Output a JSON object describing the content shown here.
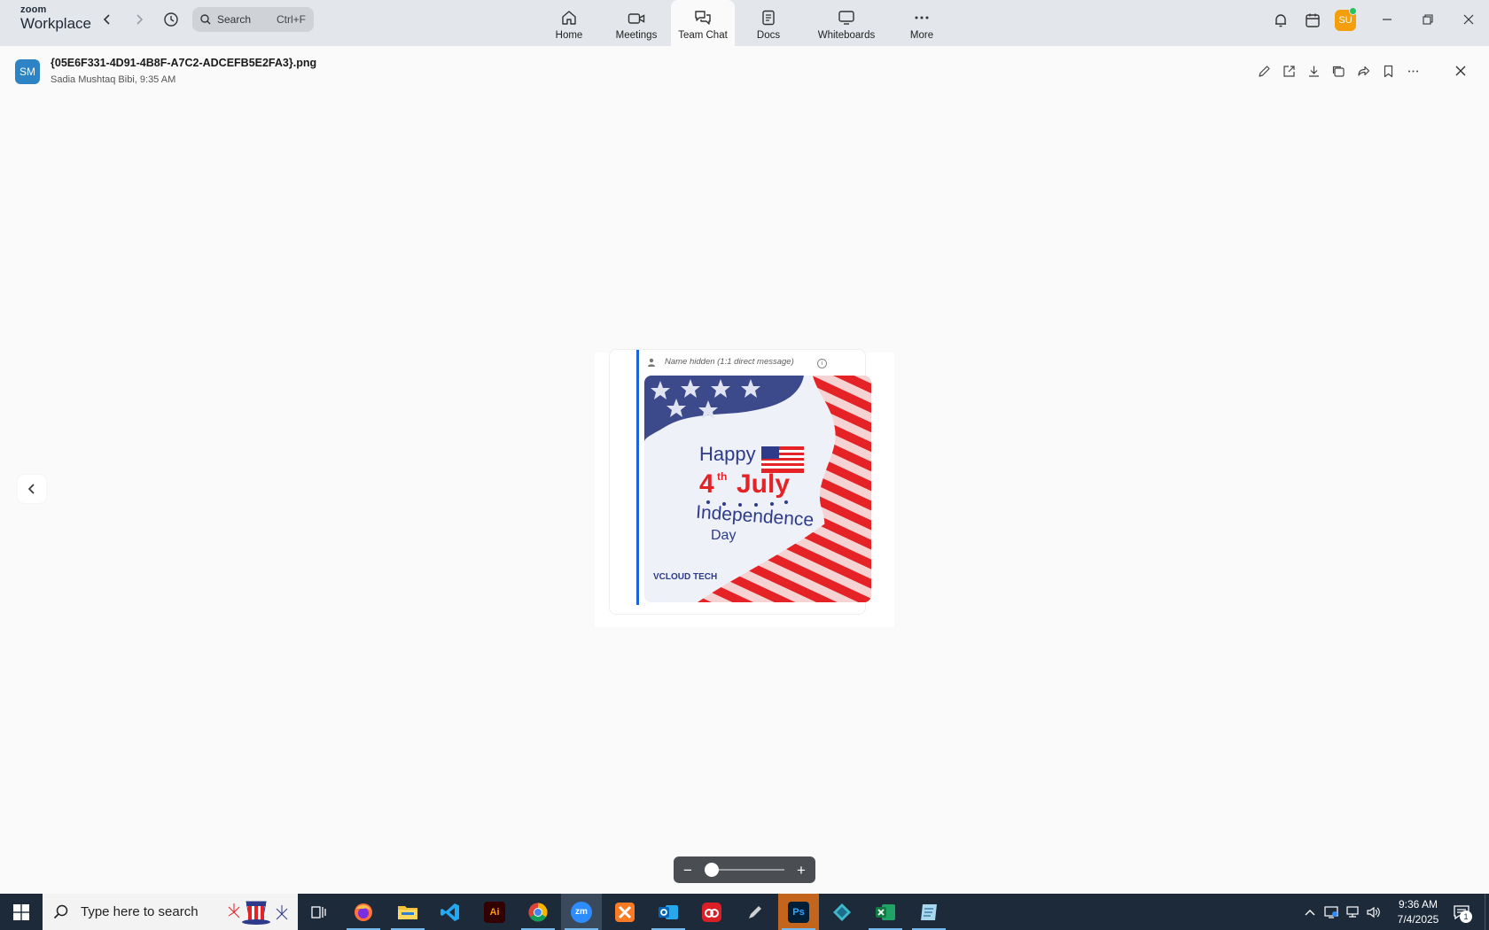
{
  "app": {
    "brand_top": "zoom",
    "brand_bottom": "Workplace"
  },
  "search": {
    "label": "Search",
    "shortcut": "Ctrl+F"
  },
  "tabs": [
    {
      "label": "Home",
      "icon": "home-icon"
    },
    {
      "label": "Meetings",
      "icon": "video-icon"
    },
    {
      "label": "Team Chat",
      "icon": "chat-icon",
      "active": true
    },
    {
      "label": "Docs",
      "icon": "document-icon"
    },
    {
      "label": "Whiteboards",
      "icon": "whiteboard-icon"
    },
    {
      "label": "More",
      "icon": "more-icon"
    }
  ],
  "user": {
    "initials": "SU",
    "avatar_color": "#f59e0b",
    "presence_color": "#22c55e"
  },
  "file": {
    "avatar_initials": "SM",
    "avatar_color": "#2d83c4",
    "name": "{05E6F331-4D91-4B8F-A7C2-ADCEFB5E2FA3}.png",
    "meta": "Sadia Mushtaq Bibi, 9:35 AM"
  },
  "preview": {
    "sender": "Name hidden (1:1 direct message)",
    "info_glyph": "i",
    "accent_color": "#1a64d6",
    "poster": {
      "line1": "Happy",
      "line2_num": "4",
      "line2_sup": "th",
      "line2_word": "July",
      "line3": "Independence",
      "line4": "Day",
      "brand": "VCLOUD TECH"
    }
  },
  "zoom_control": {
    "minus": "−",
    "plus": "+",
    "level_fraction": 0.0
  },
  "taskbar": {
    "search_placeholder": "Type here to search",
    "apps": [
      {
        "name": "task-view",
        "label": ""
      },
      {
        "name": "firefox",
        "label": ""
      },
      {
        "name": "file-explorer",
        "label": ""
      },
      {
        "name": "vscode",
        "label": ""
      },
      {
        "name": "illustrator",
        "label": "Ai"
      },
      {
        "name": "chrome",
        "label": ""
      },
      {
        "name": "zoom",
        "label": "zm"
      },
      {
        "name": "xampp",
        "label": ""
      },
      {
        "name": "outlook",
        "label": ""
      },
      {
        "name": "creative-cloud",
        "label": ""
      },
      {
        "name": "pen-tool",
        "label": ""
      },
      {
        "name": "photoshop",
        "label": "Ps"
      },
      {
        "name": "app-diamond",
        "label": ""
      },
      {
        "name": "excel",
        "label": ""
      },
      {
        "name": "notes",
        "label": ""
      }
    ],
    "time": "9:36 AM",
    "date": "7/4/2025",
    "notification_count": "1"
  }
}
